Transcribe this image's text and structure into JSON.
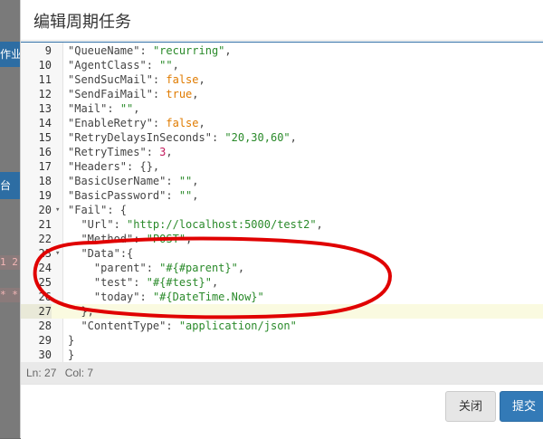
{
  "background": {
    "tab_label": "作业",
    "button_label": "台",
    "code_line_1": "1 2",
    "code_line_2": "* *"
  },
  "modal": {
    "title": "编辑周期任务"
  },
  "editor": {
    "lines": [
      {
        "num": "9",
        "text": "\"QueueName\": \"recurring\","
      },
      {
        "num": "10",
        "text": "\"AgentClass\": \"\","
      },
      {
        "num": "11",
        "text": "\"SendSucMail\": false,"
      },
      {
        "num": "12",
        "text": "\"SendFaiMail\": true,"
      },
      {
        "num": "13",
        "text": "\"Mail\": \"\","
      },
      {
        "num": "14",
        "text": "\"EnableRetry\": false,"
      },
      {
        "num": "15",
        "text": "\"RetryDelaysInSeconds\": \"20,30,60\","
      },
      {
        "num": "16",
        "text": "\"RetryTimes\": 3,"
      },
      {
        "num": "17",
        "text": "\"Headers\": {},"
      },
      {
        "num": "18",
        "text": "\"BasicUserName\": \"\","
      },
      {
        "num": "19",
        "text": "\"BasicPassword\": \"\","
      },
      {
        "num": "20",
        "text": "\"Fail\": {"
      },
      {
        "num": "21",
        "text": "  \"Url\": \"http://localhost:5000/test2\","
      },
      {
        "num": "22",
        "text": "  \"Method\": \"POST\","
      },
      {
        "num": "23",
        "text": "  \"Data\":{"
      },
      {
        "num": "24",
        "text": "    \"parent\": \"#{#parent}\","
      },
      {
        "num": "25",
        "text": "    \"test\": \"#{#test}\","
      },
      {
        "num": "26",
        "text": "    \"today\": \"#{DateTime.Now}\""
      },
      {
        "num": "27",
        "text": "  },"
      },
      {
        "num": "28",
        "text": "  \"ContentType\": \"application/json\""
      },
      {
        "num": "29",
        "text": "}"
      },
      {
        "num": "30",
        "text": "}"
      }
    ],
    "fold_markers": [
      "20",
      "23"
    ],
    "active_line": "27"
  },
  "statusbar": {
    "ln": "Ln: 27",
    "col": "Col: 7"
  },
  "footer": {
    "close_label": "关闭",
    "submit_label": "提交"
  },
  "colors": {
    "primary": "#337ab7",
    "annotation": "#e00000"
  }
}
